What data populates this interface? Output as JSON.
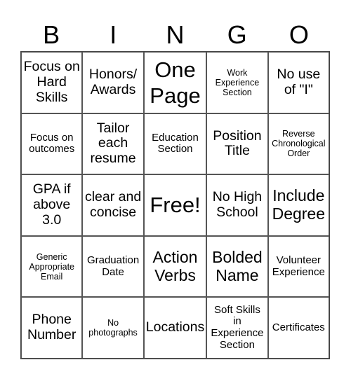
{
  "header": {
    "letters": [
      "B",
      "I",
      "N",
      "G",
      "O"
    ]
  },
  "cells": [
    {
      "text": "Focus on Hard Skills",
      "size": "s-md"
    },
    {
      "text": "Honors/ Awards",
      "size": "s-md"
    },
    {
      "text": "One Page",
      "size": "s-xl"
    },
    {
      "text": "Work Experience Section",
      "size": "s-xs"
    },
    {
      "text": "No use of \"I\"",
      "size": "s-md"
    },
    {
      "text": "Focus on outcomes",
      "size": "s-sm"
    },
    {
      "text": "Tailor each resume",
      "size": "s-md"
    },
    {
      "text": "Education Section",
      "size": "s-sm"
    },
    {
      "text": "Position Title",
      "size": "s-md"
    },
    {
      "text": "Reverse Chronological Order",
      "size": "s-xs"
    },
    {
      "text": "GPA if above 3.0",
      "size": "s-md"
    },
    {
      "text": "clear and concise",
      "size": "s-md"
    },
    {
      "text": "Free!",
      "size": "s-xl"
    },
    {
      "text": "No High School",
      "size": "s-md"
    },
    {
      "text": "Include Degree",
      "size": "s-lg"
    },
    {
      "text": "Generic Appropriate Email",
      "size": "s-xs"
    },
    {
      "text": "Graduation Date",
      "size": "s-sm"
    },
    {
      "text": "Action Verbs",
      "size": "s-lg"
    },
    {
      "text": "Bolded Name",
      "size": "s-lg"
    },
    {
      "text": "Volunteer Experience",
      "size": "s-sm"
    },
    {
      "text": "Phone Number",
      "size": "s-md"
    },
    {
      "text": "No photographs",
      "size": "s-xs"
    },
    {
      "text": "Locations",
      "size": "s-md"
    },
    {
      "text": "Soft Skills in Experience Section",
      "size": "s-sm"
    },
    {
      "text": "Certificates",
      "size": "s-sm"
    }
  ]
}
